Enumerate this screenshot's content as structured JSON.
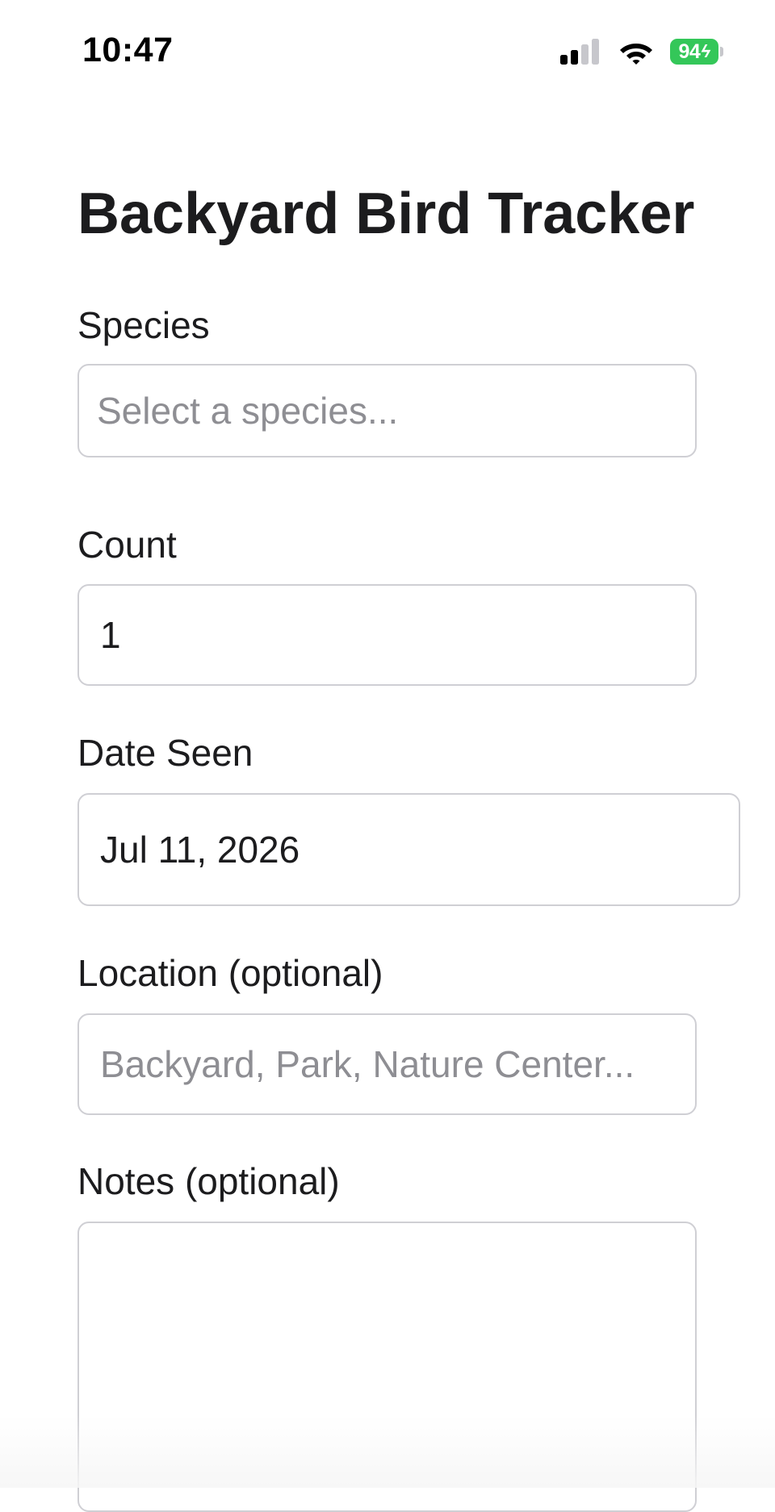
{
  "status_bar": {
    "time": "10:47",
    "battery_level": "94",
    "battery_color": "#34c759",
    "icons": [
      "signal-icon",
      "wifi-icon",
      "battery-icon"
    ]
  },
  "page": {
    "title": "Backyard Bird Tracker"
  },
  "form": {
    "species": {
      "label": "Species",
      "placeholder": "Select a species..."
    },
    "count": {
      "label": "Count",
      "value": "1"
    },
    "date_seen": {
      "label": "Date Seen",
      "value": "Jul 11, 2026"
    },
    "location": {
      "label": "Location (optional)",
      "placeholder": "Backyard, Park, Nature Center..."
    },
    "notes": {
      "label": "Notes (optional)",
      "value": ""
    }
  }
}
